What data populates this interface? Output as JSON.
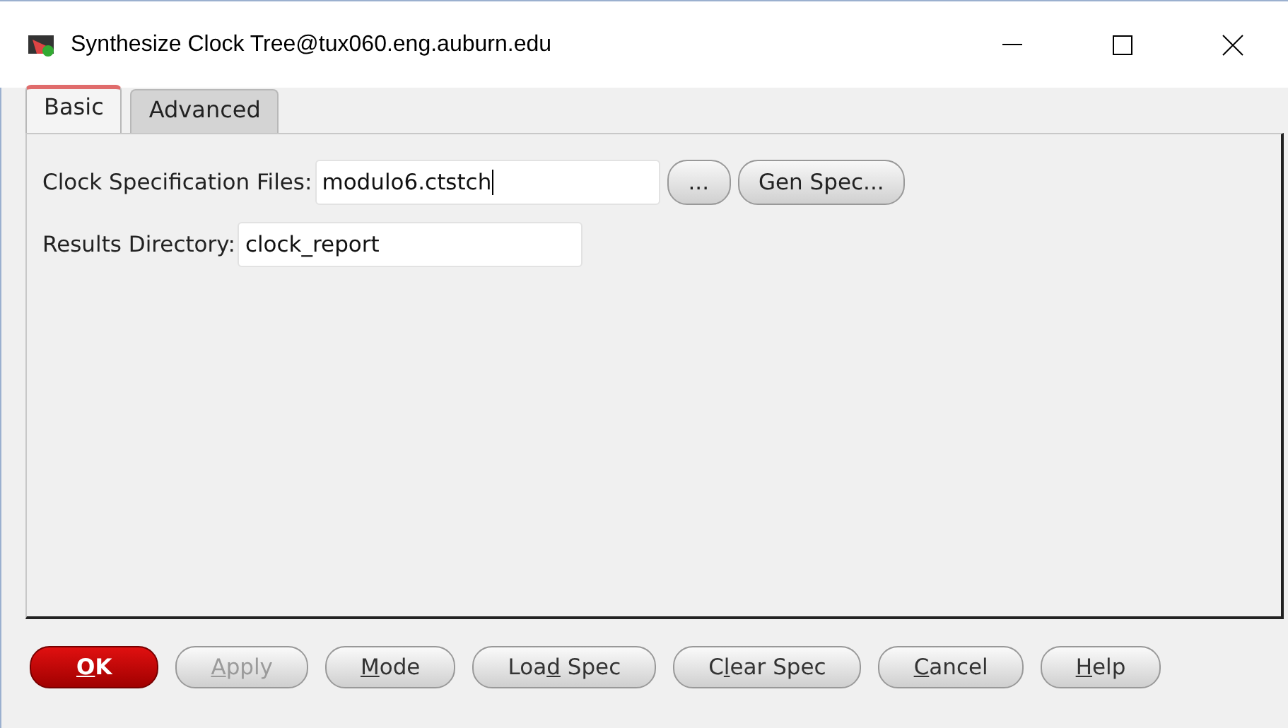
{
  "window": {
    "title": "Synthesize Clock Tree@tux060.eng.auburn.edu"
  },
  "tabs": [
    {
      "label": "Basic",
      "selected": true
    },
    {
      "label": "Advanced",
      "selected": false
    }
  ],
  "fields": [
    {
      "label": "Clock Specification Files:",
      "value": "modulo6.ctstch",
      "focused": true,
      "buttons": [
        "...",
        "Gen Spec..."
      ]
    },
    {
      "label": "Results Directory:",
      "value": "clock_report",
      "focused": false
    }
  ],
  "buttons": [
    {
      "key": "O",
      "after": "K",
      "kind": "default",
      "disabled": false
    },
    {
      "key": "A",
      "after": "pply",
      "kind": "normal",
      "disabled": true
    },
    {
      "key": "M",
      "after": "ode",
      "kind": "normal",
      "disabled": false
    },
    {
      "before": "Loa",
      "key": "d",
      "after": " Spec",
      "kind": "normal",
      "disabled": false
    },
    {
      "before": "C",
      "key": "l",
      "after": "ear Spec",
      "kind": "normal",
      "disabled": false
    },
    {
      "key": "C",
      "after": "ancel",
      "kind": "normal",
      "disabled": false
    },
    {
      "key": "H",
      "after": "elp",
      "kind": "normal",
      "disabled": false
    }
  ]
}
